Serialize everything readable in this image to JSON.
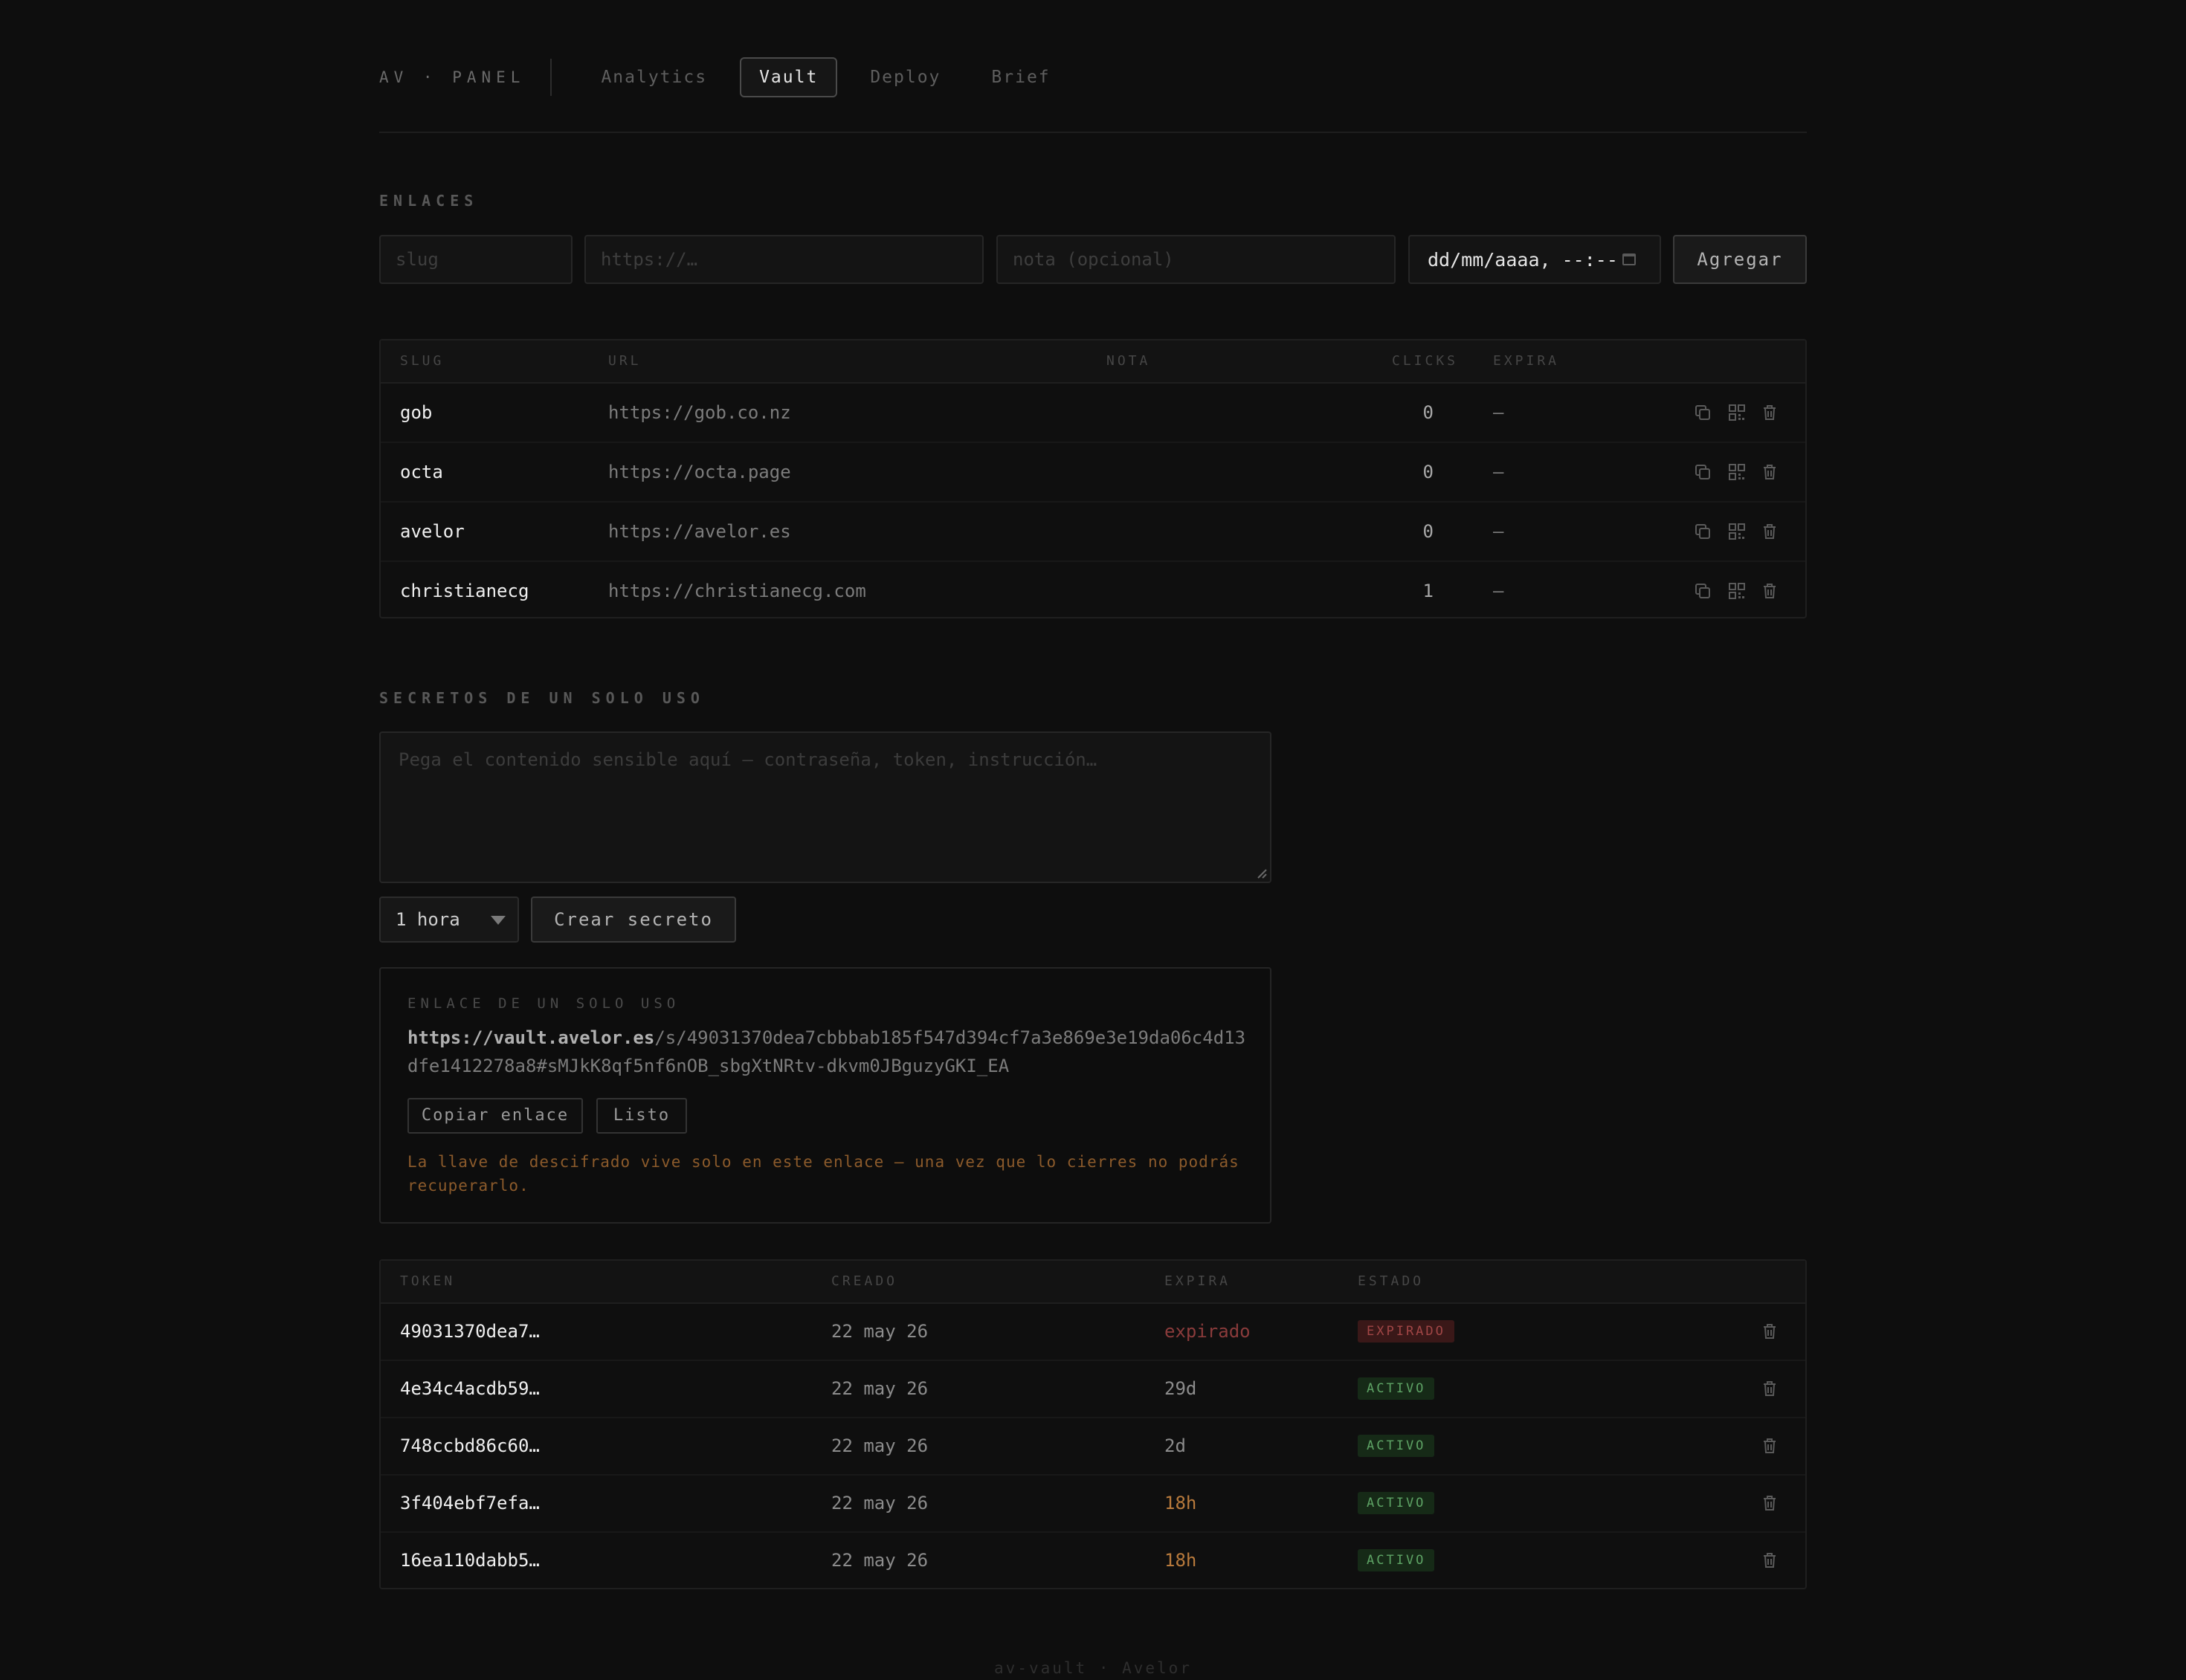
{
  "nav": {
    "brand": "AV · PANEL",
    "tabs": [
      {
        "label": "Analytics",
        "active": false
      },
      {
        "label": "Vault",
        "active": true
      },
      {
        "label": "Deploy",
        "active": false
      },
      {
        "label": "Brief",
        "active": false
      }
    ]
  },
  "links": {
    "section_title": "ENLACES",
    "form": {
      "slug_placeholder": "slug",
      "url_placeholder": "https://…",
      "note_placeholder": "nota (opcional)",
      "date_value": "dd/mm/aaaa, --:--",
      "add_label": "Agregar"
    },
    "columns": [
      "SLUG",
      "URL",
      "NOTA",
      "CLICKS",
      "EXPIRA"
    ],
    "rows": [
      {
        "slug": "gob",
        "url": "https://gob.co.nz",
        "note": "",
        "clicks": "0",
        "expires": "—"
      },
      {
        "slug": "octa",
        "url": "https://octa.page",
        "note": "",
        "clicks": "0",
        "expires": "—"
      },
      {
        "slug": "avelor",
        "url": "https://avelor.es",
        "note": "",
        "clicks": "0",
        "expires": "—"
      },
      {
        "slug": "christianecg",
        "url": "https://christianecg.com",
        "note": "",
        "clicks": "1",
        "expires": "—"
      }
    ],
    "row_icons": [
      "copy-icon",
      "qr-code-icon",
      "trash-icon"
    ]
  },
  "secrets": {
    "section_title": "SECRETOS DE UN SOLO USO",
    "textarea_placeholder": "Pega el contenido sensible aquí — contraseña, token, instrucción…",
    "duration_selected": "1 hora",
    "create_label": "Crear secreto",
    "result": {
      "title": "ENLACE DE UN SOLO USO",
      "link_host": "https://vault.avelor.es",
      "link_path": "/s/49031370dea7cbbbab185f547d394cf7a3e869e3e19da06c4d13dfe1412278a8#sMJkK8qf5nf6nOB_sbgXtNRtv-dkvm0JBguzyGKI_EA",
      "copy_label": "Copiar enlace",
      "done_label": "Listo",
      "warning": "La llave de descifrado vive solo en este enlace — una vez que lo cierres no podrás recuperarlo."
    },
    "columns": [
      "TOKEN",
      "CREADO",
      "EXPIRA",
      "ESTADO"
    ],
    "rows": [
      {
        "token": "49031370dea7…",
        "created": "22 may 26",
        "expires": "expirado",
        "status": "EXPIRADO",
        "status_color": "#a14646"
      },
      {
        "token": "4e34c4acdb59…",
        "created": "22 may 26",
        "expires": "29d",
        "status": "ACTIVO",
        "status_color": "#5ea365"
      },
      {
        "token": "748ccbd86c60…",
        "created": "22 may 26",
        "expires": "2d",
        "status": "ACTIVO",
        "status_color": "#5ea365"
      },
      {
        "token": "3f404ebf7efa…",
        "created": "22 may 26",
        "expires": "18h",
        "status": "ACTIVO",
        "status_color": "#5ea365"
      },
      {
        "token": "16ea110dabb5…",
        "created": "22 may 26",
        "expires": "18h",
        "status": "ACTIVO",
        "status_color": "#5ea365"
      }
    ]
  },
  "footer": {
    "text": "av-vault · Avelor"
  },
  "colors": {
    "background": "#0e0e0e",
    "expired": "#8a3b3b",
    "warning": "#b87a3c",
    "active_badge": "#5ea365"
  }
}
